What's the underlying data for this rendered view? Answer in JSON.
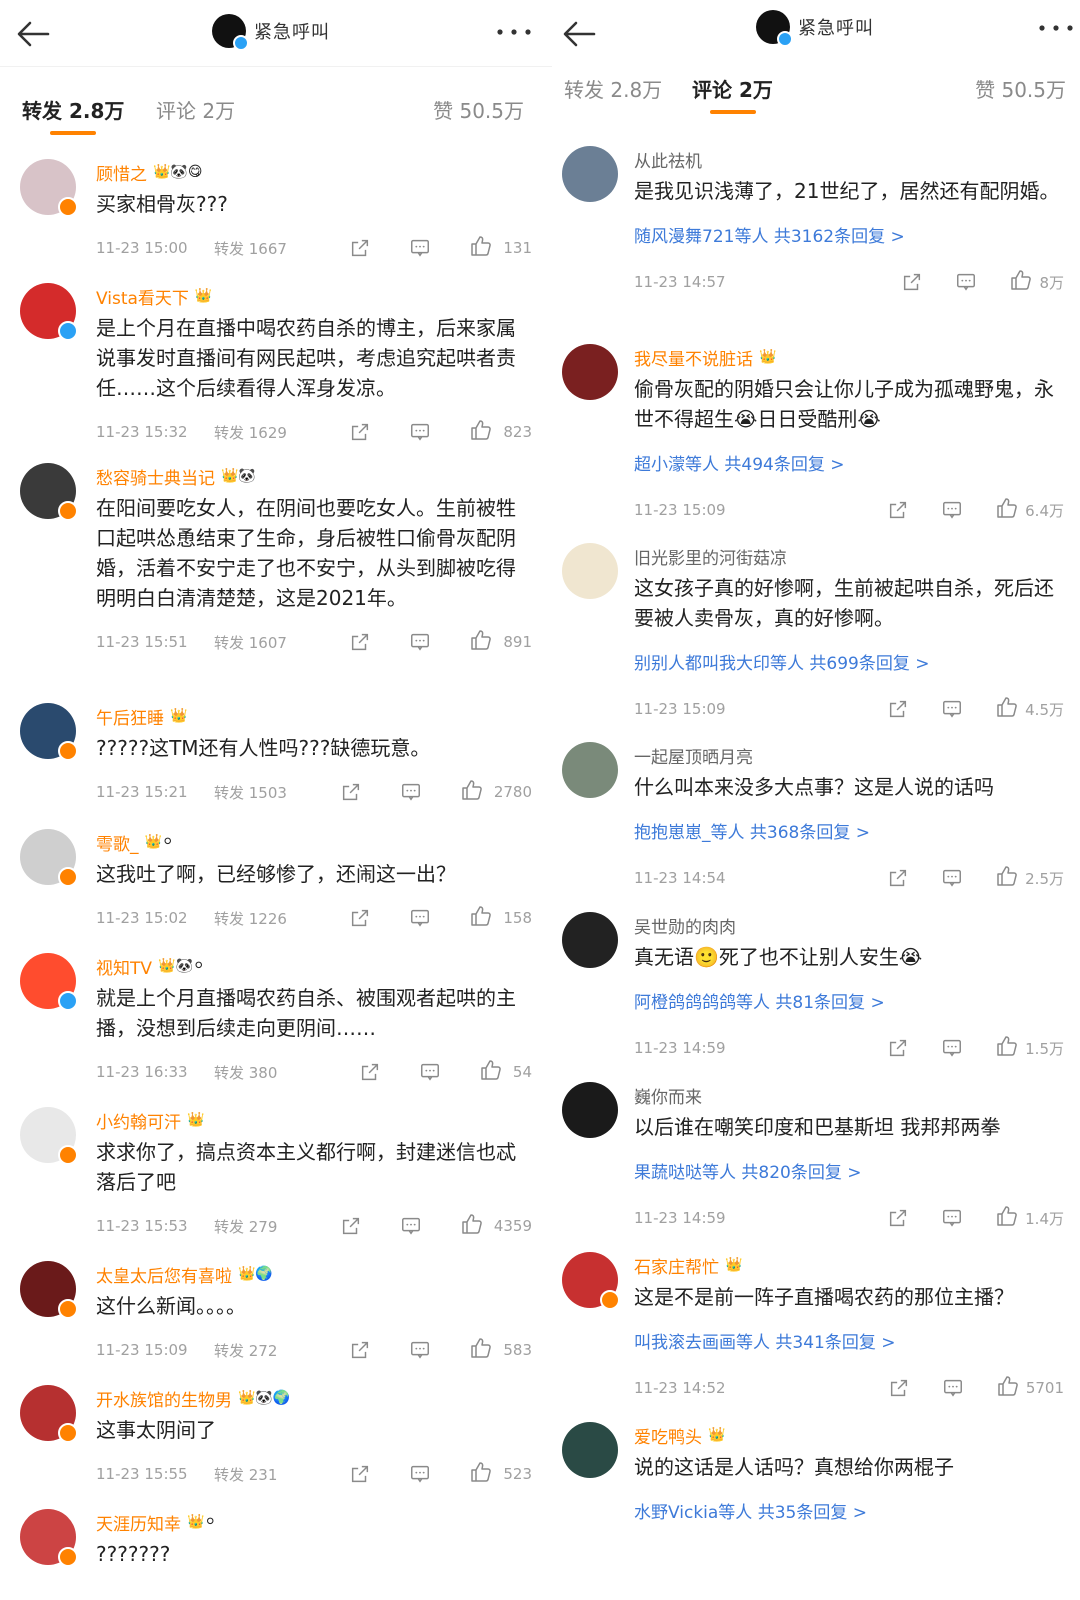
{
  "left": {
    "title": "紧急呼叫",
    "tabs": {
      "repost": "转发 2.8万",
      "comment": "评论 2万",
      "like": "赞 50.5万"
    },
    "items": [
      {
        "name": "顾惜之",
        "text": "买家相骨灰???",
        "time": "11-23 15:00",
        "repost": "转发 1667",
        "likes": "131"
      },
      {
        "name": "Vista看天下",
        "text": "是上个月在直播中喝农药自杀的博主，后来家属说事发时直播间有网民起哄，考虑追究起哄者责任……这个后续看得人浑身发凉。",
        "time": "11-23 15:32",
        "repost": "转发 1629",
        "likes": "823"
      },
      {
        "name": "愁容骑士典当记",
        "text": "在阳间要吃女人，在阴间也要吃女人。生前被牲口起哄怂恿结束了生命，身后被牲口偷骨灰配阴婚，活着不安宁走了也不安宁，从头到脚被吃得明明白白清清楚楚，这是2021年。",
        "time": "11-23 15:51",
        "repost": "转发 1607",
        "likes": "891"
      },
      {
        "name": "午后狂睡",
        "text": "?????这TM还有人性吗???缺德玩意。",
        "time": "11-23 15:21",
        "repost": "转发 1503",
        "likes": "2780"
      },
      {
        "name": "雩歌_",
        "text": "这我吐了啊，已经够惨了，还闹这一出？",
        "time": "11-23 15:02",
        "repost": "转发 1226",
        "likes": "158"
      },
      {
        "name": "视知TV",
        "text": "就是上个月直播喝农药自杀、被围观者起哄的主播，没想到后续走向更阴间……",
        "time": "11-23 16:33",
        "repost": "转发 380",
        "likes": "54"
      },
      {
        "name": "小约翰可汗",
        "text": "求求你了，搞点资本主义都行啊，封建迷信也忒落后了吧",
        "time": "11-23 15:53",
        "repost": "转发 279",
        "likes": "4359"
      },
      {
        "name": "太皇太后您有喜啦",
        "text": "这什么新闻。。。。",
        "time": "11-23 15:09",
        "repost": "转发 272",
        "likes": "583"
      },
      {
        "name": "开水族馆的生物男",
        "text": "这事太阴间了",
        "time": "11-23 15:55",
        "repost": "转发 231",
        "likes": "523"
      },
      {
        "name": "天涯历知幸",
        "text": "???????",
        "time": "",
        "repost": "",
        "likes": ""
      }
    ]
  },
  "right": {
    "title": "紧急呼叫",
    "tabs": {
      "repost": "转发 2.8万",
      "comment": "评论 2万",
      "like": "赞 50.5万"
    },
    "items": [
      {
        "name": "从此祛机",
        "text": "是我见识浅薄了，21世纪了，居然还有配阴婚。",
        "replies": "随风漫舞721等人  共3162条回复 >",
        "time": "11-23 14:57",
        "likes": "8万"
      },
      {
        "name": "我尽量不说脏话",
        "text": "偷骨灰配的阴婚只会让你儿子成为孤魂野鬼，永世不得超生😭日日受酷刑😭",
        "replies": "超小濛等人  共494条回复 >",
        "time": "11-23 15:09",
        "likes": "6.4万"
      },
      {
        "name": "旧光影里的河街菇凉",
        "text": "这女孩子真的好惨啊，生前被起哄自杀，死后还要被人卖骨灰，真的好惨啊。",
        "replies": "别别人都叫我大印等人  共699条回复 >",
        "time": "11-23 15:09",
        "likes": "4.5万"
      },
      {
        "name": "一起屋顶晒月亮",
        "text": "什么叫本来没多大点事？这是人说的话吗",
        "replies": "抱抱崽崽_等人  共368条回复 >",
        "time": "11-23 14:54",
        "likes": "2.5万"
      },
      {
        "name": "吴世勋的肉肉",
        "text": "真无语🙂死了也不让别人安生😭",
        "replies": "阿橙鸽鸽鸽鸽等人  共81条回复 >",
        "time": "11-23 14:59",
        "likes": "1.5万"
      },
      {
        "name": "巍你而来",
        "text": "以后谁在嘲笑印度和巴基斯坦 我邦邦两拳",
        "replies": "果蔬哒哒等人  共820条回复 >",
        "time": "11-23 14:59",
        "likes": "1.4万"
      },
      {
        "name": "石家庄帮忙",
        "text": "这是不是前一阵子直播喝农药的那位主播？",
        "replies": "叫我滚去画画等人  共341条回复 >",
        "time": "11-23 14:52",
        "likes": "5701"
      },
      {
        "name": "爱吃鸭头",
        "text": "说的这话是人话吗？真想给你两棍子",
        "replies": "水野Vickia等人  共35条回复 >",
        "time": "",
        "likes": ""
      }
    ]
  },
  "colors": {
    "accent": "#ff8200",
    "link": "#3d7ad9",
    "muted": "#a0a0a0"
  }
}
